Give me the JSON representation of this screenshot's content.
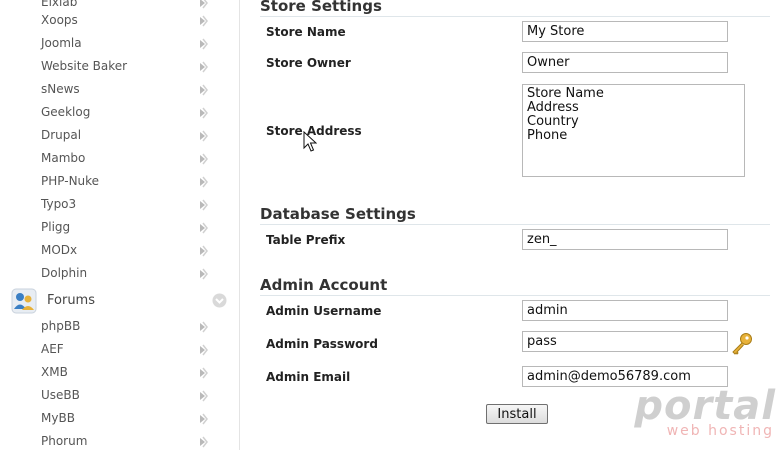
{
  "sidebar": {
    "top_partial_label": "Elxlab",
    "items_a": [
      "Xoops",
      "Joomla",
      "Website Baker",
      "sNews",
      "Geeklog",
      "Drupal",
      "Mambo",
      "PHP-Nuke",
      "Typo3",
      "Pligg",
      "MODx",
      "Dolphin"
    ],
    "category": {
      "label": "Forums",
      "icon": "forums-icon"
    },
    "items_b": [
      "phpBB",
      "AEF",
      "XMB",
      "UseBB",
      "MyBB",
      "Phorum"
    ]
  },
  "store": {
    "title": "Store Settings",
    "name_label": "Store Name",
    "name_value": "My Store",
    "owner_label": "Store Owner",
    "owner_value": "Owner",
    "address_label": "Store Address",
    "address_value": "Store Name\nAddress\nCountry\nPhone"
  },
  "database": {
    "title": "Database Settings",
    "prefix_label": "Table Prefix",
    "prefix_value": "zen_"
  },
  "admin": {
    "title": "Admin Account",
    "username_label": "Admin Username",
    "username_value": "admin",
    "password_label": "Admin Password",
    "password_value": "pass",
    "email_label": "Admin Email",
    "email_value": "admin@demo56789.com"
  },
  "install_label": "Install",
  "watermark": {
    "word": "portal",
    "sub": "web hosting"
  },
  "colors": {
    "arrow": "#b9b9b9",
    "key": "#e8b23a",
    "forum_icon_blue": "#3b7fc4"
  },
  "icons": {
    "item_arrow": "arrow-right-icon",
    "category_chevron": "chevron-down-icon",
    "password_key": "key-icon",
    "pointer": "mouse-cursor-icon"
  }
}
